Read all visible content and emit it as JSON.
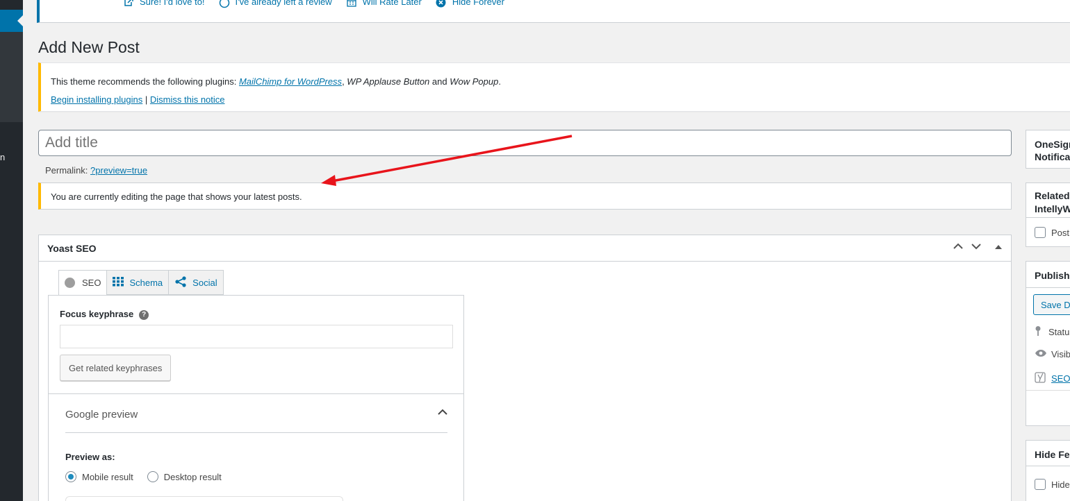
{
  "review_notice": {
    "items": [
      {
        "icon": "external-link-icon",
        "label": "Sure! I'd love to!"
      },
      {
        "icon": "smiley-icon",
        "label": "I've already left a review"
      },
      {
        "icon": "calendar-icon",
        "label": "Will Rate Later"
      },
      {
        "icon": "dismiss-icon",
        "label": "Hide Forever"
      }
    ]
  },
  "sidebar": {
    "fragment_label": "n"
  },
  "page": {
    "title": "Add New Post"
  },
  "plugin_notice": {
    "intro": "This theme recommends the following plugins: ",
    "plugin1": "MailChimp for WordPress",
    "sep1": ", ",
    "plugin2": "WP Applause Button",
    "and": " and ",
    "plugin3": "Wow Popup",
    "end": ".",
    "begin_link": "Begin installing plugins",
    "pipe": " | ",
    "dismiss_link": "Dismiss this notice"
  },
  "editor": {
    "title_placeholder": "Add title",
    "permalink_label": "Permalink: ",
    "permalink_value": "?preview=true",
    "editing_notice": "You are currently editing the page that shows your latest posts."
  },
  "yoast": {
    "title": "Yoast SEO",
    "tabs": [
      {
        "label": "SEO",
        "icon": "seo-score-dot-icon"
      },
      {
        "label": "Schema",
        "icon": "grid-icon"
      },
      {
        "label": "Social",
        "icon": "share-icon"
      }
    ],
    "focus_label": "Focus keyphrase",
    "focus_value": "",
    "related_button": "Get related keyphrases",
    "google_preview": "Google preview",
    "preview_as": "Preview as:",
    "mobile": "Mobile result",
    "desktop": "Desktop result",
    "selected": "Mobile result"
  },
  "right_sidebar": {
    "onesignal_line1": "OneSignal Push",
    "onesignal_line2": "Notifications",
    "related_line1": "Related Posts by",
    "related_line2": "IntellyWP",
    "related_checkbox": "Post",
    "publish_title": "Publish",
    "save_draft": "Save Draft",
    "status": "Status:",
    "visibility": "Visibility:",
    "seo_link": "SEO",
    "seo_colon": ":",
    "hide_title": "Hide Featured Image",
    "hide_checkbox": "Hide"
  },
  "colors": {
    "accent": "#0073aa",
    "warning": "#ffb900",
    "arrow": "#e8141b"
  }
}
